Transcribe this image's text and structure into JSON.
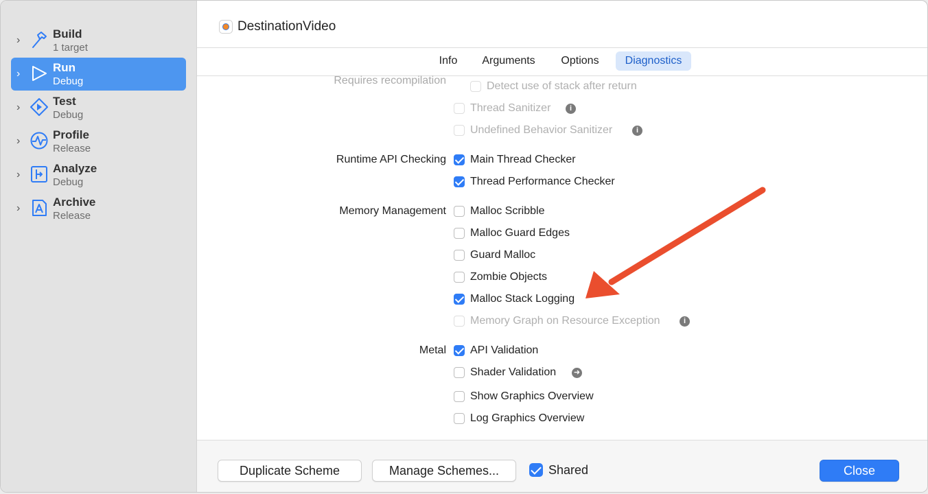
{
  "window": {
    "title": "DestinationVideo",
    "app_icon": "app-icon"
  },
  "sidebar": {
    "items": [
      {
        "title": "Build",
        "subtitle": "1 target",
        "icon": "hammer-icon"
      },
      {
        "title": "Run",
        "subtitle": "Debug",
        "icon": "play-icon",
        "selected": true
      },
      {
        "title": "Test",
        "subtitle": "Debug",
        "icon": "test-diamond-icon"
      },
      {
        "title": "Profile",
        "subtitle": "Release",
        "icon": "profile-wave-icon"
      },
      {
        "title": "Analyze",
        "subtitle": "Debug",
        "icon": "analyze-icon"
      },
      {
        "title": "Archive",
        "subtitle": "Release",
        "icon": "archive-icon"
      }
    ]
  },
  "tabs": {
    "info": "Info",
    "arguments": "Arguments",
    "options": "Options",
    "diagnostics": "Diagnostics",
    "active": "Diagnostics"
  },
  "form": {
    "requires_recompilation_label": "Requires recompilation",
    "detect_stack_after_return": {
      "label": "Detect use of stack after return",
      "checked": false,
      "enabled": false
    },
    "thread_sanitizer": {
      "label": "Thread Sanitizer",
      "checked": false,
      "enabled": false
    },
    "undefined_behavior_sanitizer": {
      "label": "Undefined Behavior Sanitizer",
      "checked": false,
      "enabled": false
    },
    "runtime_api_checking_label": "Runtime API Checking",
    "main_thread_checker": {
      "label": "Main Thread Checker",
      "checked": true
    },
    "thread_performance_checker": {
      "label": "Thread Performance Checker",
      "checked": true
    },
    "memory_management_label": "Memory Management",
    "malloc_scribble": {
      "label": "Malloc Scribble",
      "checked": false
    },
    "malloc_guard_edges": {
      "label": "Malloc Guard Edges",
      "checked": false
    },
    "guard_malloc": {
      "label": "Guard Malloc",
      "checked": false
    },
    "zombie_objects": {
      "label": "Zombie Objects",
      "checked": false
    },
    "malloc_stack_logging": {
      "label": "Malloc Stack Logging",
      "checked": true
    },
    "memory_graph_resource_exception": {
      "label": "Memory Graph on Resource Exception",
      "checked": false,
      "enabled": false
    },
    "metal_label": "Metal",
    "api_validation": {
      "label": "API Validation",
      "checked": true
    },
    "shader_validation": {
      "label": "Shader Validation",
      "checked": false
    },
    "show_graphics_overview": {
      "label": "Show Graphics Overview",
      "checked": false
    },
    "log_graphics_overview": {
      "label": "Log Graphics Overview",
      "checked": false
    }
  },
  "footer": {
    "duplicate_scheme": "Duplicate Scheme",
    "manage_schemes": "Manage Schemes...",
    "shared_label": "Shared",
    "shared_checked": true,
    "close": "Close"
  },
  "annotation": {
    "arrow_color": "#ea4e2e",
    "points_to": "Malloc Stack Logging"
  }
}
